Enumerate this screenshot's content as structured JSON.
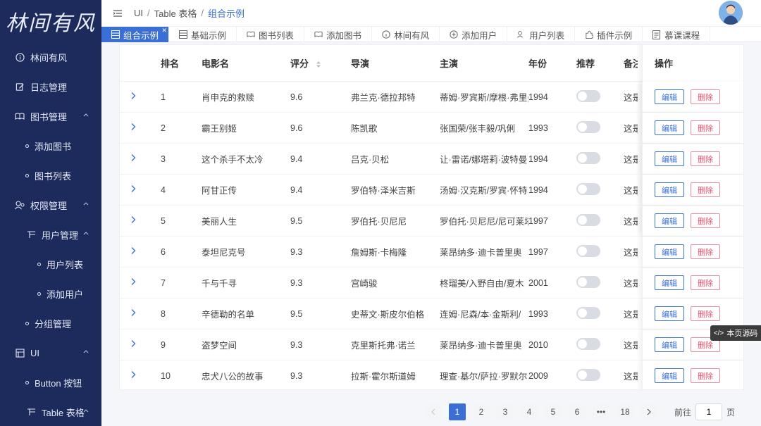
{
  "app": {
    "logo_text": "林间有风"
  },
  "sidebar": {
    "items": [
      {
        "label": "林间有风",
        "icon": "info-icon"
      },
      {
        "label": "日志管理",
        "icon": "edit-icon"
      },
      {
        "label": "图书管理",
        "icon": "book-icon"
      },
      {
        "label": "添加图书"
      },
      {
        "label": "图书列表"
      },
      {
        "label": "权限管理",
        "icon": "users-icon"
      },
      {
        "label": "用户管理",
        "icon": "grid-icon"
      },
      {
        "label": "用户列表"
      },
      {
        "label": "添加用户"
      },
      {
        "label": "分组管理"
      },
      {
        "label": "UI",
        "icon": "layout-icon"
      },
      {
        "label": "Button 按钮"
      },
      {
        "label": "Table 表格",
        "icon": "grid-icon"
      }
    ]
  },
  "breadcrumb": {
    "items": [
      "UI",
      "Table 表格",
      "组合示例"
    ]
  },
  "tabs": [
    {
      "label": "组合示例",
      "icon": "table-icon"
    },
    {
      "label": "基础示例",
      "icon": "table-icon"
    },
    {
      "label": "图书列表",
      "icon": "book-icon"
    },
    {
      "label": "添加图书",
      "icon": "book-icon"
    },
    {
      "label": "林间有风",
      "icon": "info-icon"
    },
    {
      "label": "添加用户",
      "icon": "plus-circle-icon"
    },
    {
      "label": "用户列表",
      "icon": "users-icon"
    },
    {
      "label": "插件示例",
      "icon": "puzzle-icon"
    },
    {
      "label": "慕课课程",
      "icon": "document-icon"
    }
  ],
  "table": {
    "columns": {
      "rank": "排名",
      "name": "电影名",
      "score": "评分",
      "director": "导演",
      "starring": "主演",
      "year": "年份",
      "recommend": "推荐",
      "note": "备注",
      "actions": "操作"
    },
    "edit_label": "编辑",
    "delete_label": "删除",
    "rows": [
      {
        "rank": "1",
        "name": "肖申克的救赎",
        "score": "9.6",
        "director": "弗兰克·德拉邦特",
        "starring": "蒂姆·罗宾斯/摩根·弗里曼",
        "year": "1994",
        "note": "这是"
      },
      {
        "rank": "2",
        "name": "霸王别姬",
        "score": "9.6",
        "director": "陈凯歌",
        "starring": "张国荣/张丰毅/巩俐",
        "year": "1993",
        "note": "这是"
      },
      {
        "rank": "3",
        "name": "这个杀手不太冷",
        "score": "9.4",
        "director": "吕克·贝松",
        "starring": "让·雷诺/娜塔莉·波特曼",
        "year": "1994",
        "note": "这是"
      },
      {
        "rank": "4",
        "name": "阿甘正传",
        "score": "9.4",
        "director": "罗伯特·泽米吉斯",
        "starring": "汤姆·汉克斯/罗宾·怀特",
        "year": "1994",
        "note": "这是"
      },
      {
        "rank": "5",
        "name": "美丽人生",
        "score": "9.5",
        "director": "罗伯托·贝尼尼",
        "starring": "罗伯托·贝尼尼/尼可莱塔",
        "year": "1997",
        "note": "这是"
      },
      {
        "rank": "6",
        "name": "泰坦尼克号",
        "score": "9.3",
        "director": "詹姆斯·卡梅隆",
        "starring": "莱昂纳多·迪卡普里奥",
        "year": "1997",
        "note": "这是"
      },
      {
        "rank": "7",
        "name": "千与千寻",
        "score": "9.3",
        "director": "宫崎骏",
        "starring": "柊瑠美/入野自由/夏木",
        "year": "2001",
        "note": "这是"
      },
      {
        "rank": "8",
        "name": "辛德勒的名单",
        "score": "9.5",
        "director": "史蒂文·斯皮尔伯格",
        "starring": "连姆·尼森/本·金斯利/",
        "year": "1993",
        "note": "这是"
      },
      {
        "rank": "9",
        "name": "盗梦空间",
        "score": "9.3",
        "director": "克里斯托弗·诺兰",
        "starring": "莱昂纳多·迪卡普里奥",
        "year": "2010",
        "note": "这是"
      },
      {
        "rank": "10",
        "name": "忠犬八公的故事",
        "score": "9.3",
        "director": "拉斯·霍尔斯道姆",
        "starring": "理查·基尔/萨拉·罗默尔",
        "year": "2009",
        "note": "这是"
      }
    ]
  },
  "pagination": {
    "pages": [
      "1",
      "2",
      "3",
      "4",
      "5",
      "6",
      "•••",
      "18"
    ],
    "current": "1",
    "goto_prefix": "前往",
    "goto_value": "1",
    "goto_suffix": "页"
  },
  "source_button": {
    "label": "本页源码"
  },
  "colors": {
    "sidebar_bg": "#1c2a5c",
    "accent": "#3a6fd6",
    "danger": "#e0506b"
  }
}
